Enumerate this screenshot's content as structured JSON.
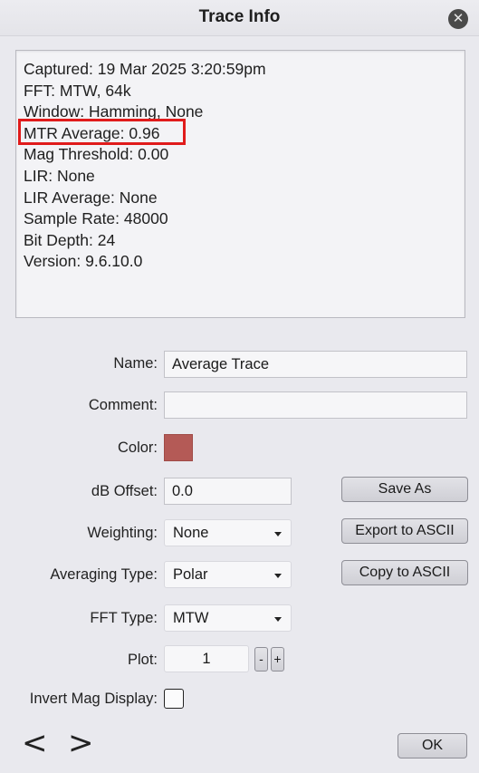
{
  "window": {
    "title": "Trace Info",
    "close_icon": "close-icon"
  },
  "info": {
    "lines": [
      "Captured: 19 Mar 2025 3:20:59pm",
      "FFT: MTW, 64k",
      "Window: Hamming, None",
      "MTR Average: 0.96",
      "Mag Threshold: 0.00",
      "LIR: None",
      "LIR Average: None",
      "Sample Rate: 48000",
      "Bit Depth: 24",
      "Version: 9.6.10.0"
    ],
    "highlight_color": "#e01b1b"
  },
  "form": {
    "name_label": "Name:",
    "name_value": "Average Trace",
    "comment_label": "Comment:",
    "comment_value": "",
    "color_label": "Color:",
    "color_value": "#b45a56",
    "db_offset_label": "dB Offset:",
    "db_offset_value": "0.0",
    "weighting_label": "Weighting:",
    "weighting_value": "None",
    "averaging_label": "Averaging Type:",
    "averaging_value": "Polar",
    "fft_type_label": "FFT Type:",
    "fft_type_value": "MTW",
    "plot_label": "Plot:",
    "plot_value": "1",
    "plot_minus": "-",
    "plot_plus": "+",
    "invert_label": "Invert Mag Display:",
    "invert_checked": false
  },
  "buttons": {
    "save_as": "Save As",
    "export_ascii": "Export to ASCII",
    "copy_ascii": "Copy to ASCII",
    "ok": "OK",
    "prev": "<",
    "next": ">"
  }
}
